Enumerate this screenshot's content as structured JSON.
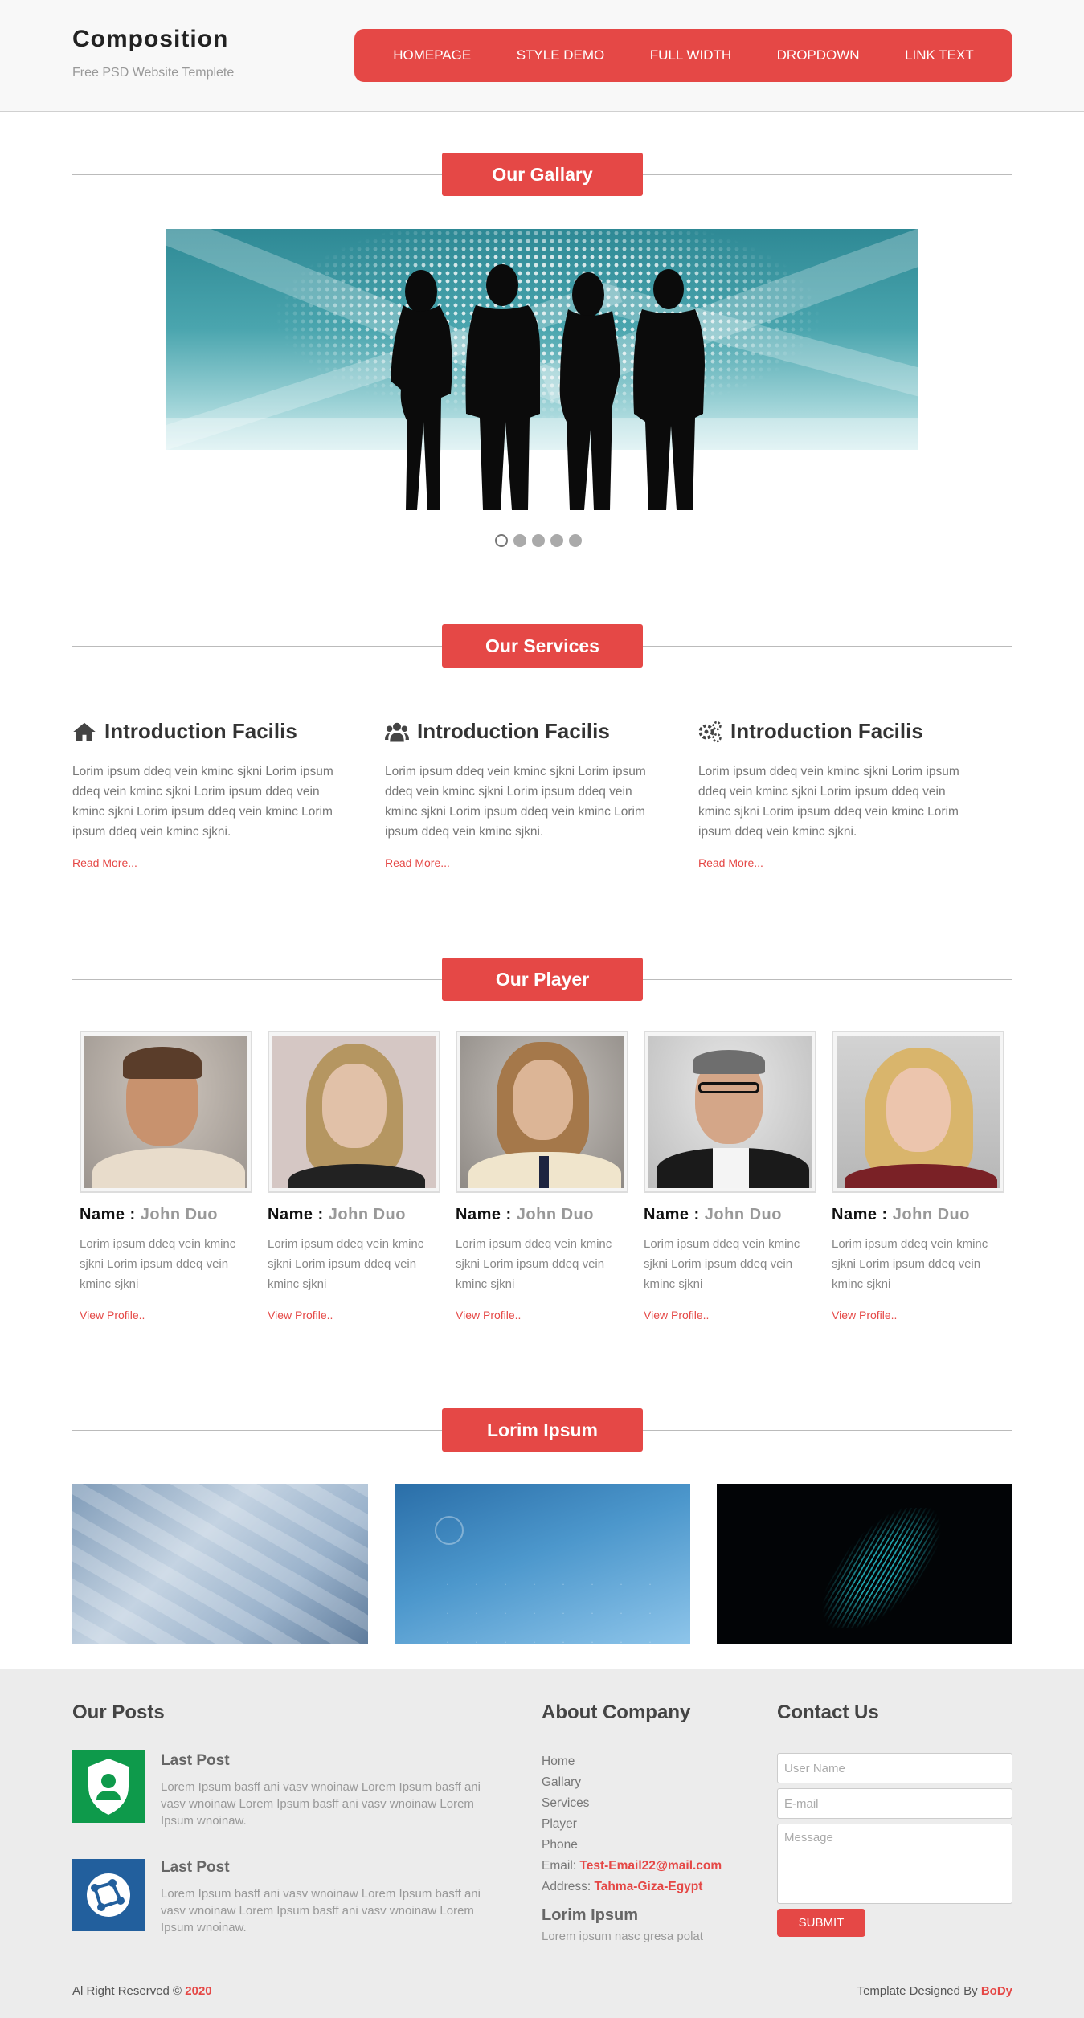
{
  "header": {
    "logo": "Composition",
    "tagline": "Free PSD Website Templete",
    "nav": [
      "HOMEPAGE",
      "STYLE DEMO",
      "FULL WIDTH",
      "DROPDOWN",
      "LINK TEXT"
    ]
  },
  "sections": {
    "gallery": "Our Gallary",
    "services": "Our Services",
    "player": "Our Player",
    "lorim": "Lorim Ipsum"
  },
  "services": [
    {
      "icon": "home-icon",
      "title": "Introduction Facilis",
      "text": "Lorim ipsum ddeq vein kminc sjkni Lorim ipsum ddeq vein kminc sjkni Lorim ipsum ddeq vein kminc sjkni Lorim ipsum ddeq vein kminc Lorim ipsum ddeq vein kminc sjkni.",
      "link": "Read More..."
    },
    {
      "icon": "users-icon",
      "title": "Introduction Facilis",
      "text": "Lorim ipsum ddeq vein kminc sjkni Lorim ipsum ddeq vein kminc sjkni Lorim ipsum ddeq vein kminc sjkni Lorim ipsum ddeq vein kminc Lorim ipsum ddeq vein kminc sjkni.",
      "link": "Read More..."
    },
    {
      "icon": "gears-icon",
      "title": "Introduction Facilis",
      "text": "Lorim ipsum ddeq vein kminc sjkni Lorim ipsum ddeq vein kminc sjkni Lorim ipsum ddeq vein kminc sjkni Lorim ipsum ddeq vein kminc Lorim ipsum ddeq vein kminc sjkni.",
      "link": "Read More..."
    }
  ],
  "players": [
    {
      "label": "Name :",
      "name": "John Duo",
      "text": "Lorim ipsum ddeq vein kminc sjkni Lorim ipsum ddeq vein kminc sjkni",
      "link": "View Profile.."
    },
    {
      "label": "Name :",
      "name": "John Duo",
      "text": "Lorim ipsum ddeq vein kminc sjkni Lorim ipsum ddeq vein kminc sjkni",
      "link": "View Profile.."
    },
    {
      "label": "Name :",
      "name": "John Duo",
      "text": "Lorim ipsum ddeq vein kminc sjkni Lorim ipsum ddeq vein kminc sjkni",
      "link": "View Profile.."
    },
    {
      "label": "Name :",
      "name": "John Duo",
      "text": "Lorim ipsum ddeq vein kminc sjkni Lorim ipsum ddeq vein kminc sjkni",
      "link": "View Profile.."
    },
    {
      "label": "Name :",
      "name": "John Duo",
      "text": "Lorim ipsum ddeq vein kminc sjkni Lorim ipsum ddeq vein kminc sjkni",
      "link": "View Profile.."
    }
  ],
  "footer": {
    "posts_title": "Our Posts",
    "posts": [
      {
        "title": "Last Post",
        "text": "Lorem Ipsum basff ani vasv wnoinaw Lorem Ipsum basff ani vasv wnoinaw Lorem Ipsum basff ani vasv wnoinaw Lorem Ipsum wnoinaw."
      },
      {
        "title": "Last Post",
        "text": "Lorem Ipsum basff ani vasv wnoinaw Lorem Ipsum basff ani vasv wnoinaw Lorem Ipsum basff ani vasv wnoinaw Lorem Ipsum wnoinaw."
      }
    ],
    "about_title": "About Company",
    "about_links": [
      "Home",
      "Gallary",
      "Services",
      "Player",
      "Phone"
    ],
    "email_label": "Email:",
    "email": "Test-Email22@mail.com",
    "address_label": "Address:",
    "address": "Tahma-Giza-Egypt",
    "lorim_title": "Lorim Ipsum",
    "lorim_text": "Lorem ipsum nasc gresa polat",
    "contact_title": "Contact Us",
    "placeholders": {
      "name": "User Name",
      "email": "E-mail",
      "message": "Message"
    },
    "submit": "SUBMIT",
    "copyright": "Al Right Reserved ©",
    "year": "2020",
    "designed": "Template Designed By",
    "designer": "BoDy"
  },
  "colors": {
    "accent": "#e54846"
  }
}
